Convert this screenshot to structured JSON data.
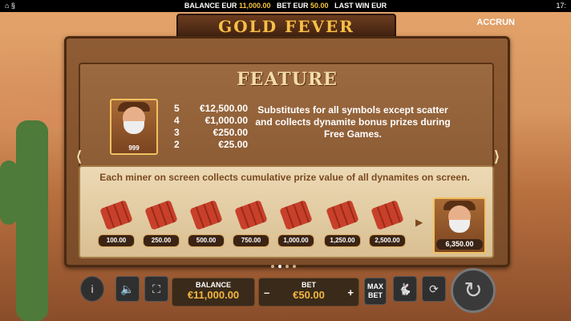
{
  "topbar": {
    "balance_label": "BALANCE EUR",
    "balance_value": "11,000.00",
    "bet_label": "BET EUR",
    "bet_value": "50.00",
    "last_win_label": "LAST WIN EUR",
    "time": "17:"
  },
  "logo": {
    "title": "GOLD FEVER",
    "brand": "ACCRUN"
  },
  "feature": {
    "title": "FEATURE",
    "symbol_count_badge": "999",
    "paytable": [
      {
        "count": "5",
        "value": "€12,500.00"
      },
      {
        "count": "4",
        "value": "€1,000.00"
      },
      {
        "count": "3",
        "value": "€250.00"
      },
      {
        "count": "2",
        "value": "€25.00"
      }
    ],
    "description": "Substitutes for all symbols except scatter and collects dynamite bonus prizes during Free Games.",
    "lower_text": "Each miner on screen collects cumulative prize value of all dynamites on screen.",
    "dynamites": [
      "100.00",
      "250.00",
      "500.00",
      "750.00",
      "1,000.00",
      "1,250.00",
      "2,500.00"
    ],
    "miner_total": "6,350.00"
  },
  "controls": {
    "info": "i",
    "balance_label": "BALANCE",
    "balance_value": "€11,000.00",
    "bet_label": "BET",
    "bet_value": "€50.00",
    "minus": "–",
    "plus": "+",
    "max_bet": "MAX BET"
  },
  "icons": [
    "info-icon",
    "speaker-icon",
    "fullscreen-icon",
    "rabbit-icon",
    "autoplay-icon",
    "spin-icon"
  ]
}
